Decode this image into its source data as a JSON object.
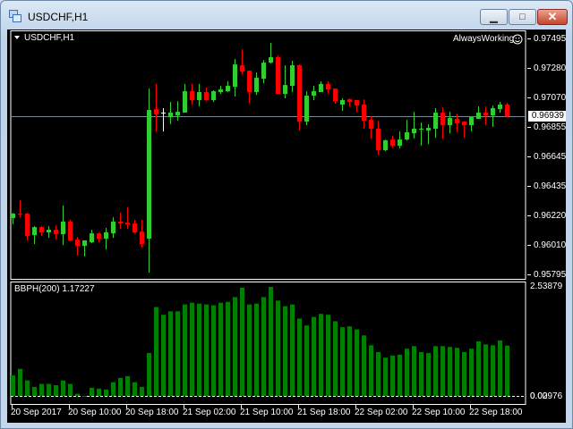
{
  "window": {
    "title": "USDCHF,H1",
    "minimize": "▁",
    "maximize": "□",
    "close": "✕"
  },
  "chart": {
    "symbol_label": "USDCHF,H1",
    "expert_label": "AlwaysWorking",
    "expert_icon": "smiley-icon",
    "current_price": "0.96939",
    "price_ticks": [
      "0.97495",
      "0.97280",
      "0.97070",
      "0.96855",
      "0.96645",
      "0.96435",
      "0.96220",
      "0.96010",
      "0.95795"
    ],
    "indicator_label": "BBPH(200) 1.17227",
    "indicator_ticks": [
      "2.53879",
      "0.02976",
      "0.00"
    ],
    "time_labels": [
      "20 Sep 2017",
      "20 Sep 10:00",
      "20 Sep 18:00",
      "21 Sep 02:00",
      "21 Sep 10:00",
      "21 Sep 18:00",
      "22 Sep 02:00",
      "22 Sep 10:00",
      "22 Sep 18:00"
    ],
    "colors": {
      "bull": "#32cd32",
      "bear": "#ff0000",
      "hist": "#008000",
      "bg": "#000000",
      "price_line": "#778899"
    }
  },
  "chart_data": {
    "type": "candlestick",
    "ylim": [
      0.95795,
      0.97495
    ],
    "ohlc": [
      [
        0.96207,
        0.96245,
        0.96162,
        0.96239
      ],
      [
        0.96239,
        0.96335,
        0.96213,
        0.96232
      ],
      [
        0.96239,
        0.96245,
        0.96046,
        0.96078
      ],
      [
        0.96084,
        0.96149,
        0.9602,
        0.96142
      ],
      [
        0.96142,
        0.96149,
        0.96078,
        0.96104
      ],
      [
        0.96104,
        0.96149,
        0.96065,
        0.96123
      ],
      [
        0.96123,
        0.96155,
        0.96052,
        0.96091
      ],
      [
        0.96091,
        0.96297,
        0.96013,
        0.96181
      ],
      [
        0.96181,
        0.96194,
        0.96039,
        0.96046
      ],
      [
        0.96052,
        0.96071,
        0.95936,
        0.96007
      ],
      [
        0.96007,
        0.96046,
        0.9593,
        0.96046
      ],
      [
        0.96033,
        0.96123,
        0.96026,
        0.96097
      ],
      [
        0.96097,
        0.96104,
        0.96033,
        0.96059
      ],
      [
        0.96059,
        0.96136,
        0.95981,
        0.96104
      ],
      [
        0.96097,
        0.96213,
        0.96065,
        0.96181
      ],
      [
        0.96181,
        0.96245,
        0.96129,
        0.96168
      ],
      [
        0.96174,
        0.96284,
        0.96129,
        0.96162
      ],
      [
        0.96168,
        0.96194,
        0.96097,
        0.96104
      ],
      [
        0.9611,
        0.96194,
        0.95994,
        0.9602
      ],
      [
        0.96059,
        0.9714,
        0.95814,
        0.96986
      ],
      [
        0.96992,
        0.97173,
        0.96831,
        0.96954
      ],
      [
        0.96967,
        0.96999,
        0.96831,
        0.96967
      ],
      [
        0.96934,
        0.97044,
        0.96883,
        0.96967
      ],
      [
        0.96947,
        0.9705,
        0.96909,
        0.96973
      ],
      [
        0.96967,
        0.97173,
        0.96967,
        0.97121
      ],
      [
        0.97121,
        0.97173,
        0.97025,
        0.97057
      ],
      [
        0.97057,
        0.97173,
        0.97012,
        0.97115
      ],
      [
        0.97115,
        0.97147,
        0.9705,
        0.97057
      ],
      [
        0.97057,
        0.97128,
        0.97044,
        0.97121
      ],
      [
        0.97115,
        0.9716,
        0.97102,
        0.97134
      ],
      [
        0.97121,
        0.97192,
        0.97115,
        0.9716
      ],
      [
        0.97153,
        0.97353,
        0.97083,
        0.97314
      ],
      [
        0.97308,
        0.97424,
        0.97244,
        0.97263
      ],
      [
        0.97269,
        0.97269,
        0.97037,
        0.97115
      ],
      [
        0.97115,
        0.97256,
        0.97095,
        0.97218
      ],
      [
        0.97211,
        0.97346,
        0.97179,
        0.97327
      ],
      [
        0.97327,
        0.97469,
        0.97321,
        0.97366
      ],
      [
        0.97366,
        0.97379,
        0.97102,
        0.97102
      ],
      [
        0.97102,
        0.97308,
        0.9707,
        0.97166
      ],
      [
        0.9716,
        0.9734,
        0.97115,
        0.97308
      ],
      [
        0.97308,
        0.97314,
        0.96838,
        0.96902
      ],
      [
        0.96902,
        0.97121,
        0.96876,
        0.97089
      ],
      [
        0.97089,
        0.9716,
        0.97057,
        0.97121
      ],
      [
        0.97115,
        0.97192,
        0.97115,
        0.97173
      ],
      [
        0.97173,
        0.97192,
        0.97102,
        0.97134
      ],
      [
        0.9714,
        0.9714,
        0.97031,
        0.9705
      ],
      [
        0.97025,
        0.9707,
        0.96979,
        0.97057
      ],
      [
        0.97063,
        0.9707,
        0.97012,
        0.97044
      ],
      [
        0.97057,
        0.97057,
        0.96973,
        0.97018
      ],
      [
        0.97025,
        0.97063,
        0.96851,
        0.96909
      ],
      [
        0.96915,
        0.96941,
        0.9678,
        0.96851
      ],
      [
        0.96851,
        0.96909,
        0.96664,
        0.96696
      ],
      [
        0.96696,
        0.96773,
        0.9669,
        0.96767
      ],
      [
        0.96773,
        0.96799,
        0.96715,
        0.96728
      ],
      [
        0.96728,
        0.96831,
        0.96709,
        0.96773
      ],
      [
        0.96773,
        0.96915,
        0.96767,
        0.96825
      ],
      [
        0.96818,
        0.96973,
        0.9678,
        0.96851
      ],
      [
        0.96844,
        0.96896,
        0.96728,
        0.96851
      ],
      [
        0.96838,
        0.96883,
        0.96741,
        0.96857
      ],
      [
        0.96851,
        0.96999,
        0.96786,
        0.96967
      ],
      [
        0.96967,
        0.97005,
        0.9678,
        0.96876
      ],
      [
        0.96876,
        0.96973,
        0.96818,
        0.96928
      ],
      [
        0.96922,
        0.9696,
        0.96825,
        0.96889
      ],
      [
        0.96902,
        0.96902,
        0.96786,
        0.96876
      ],
      [
        0.96876,
        0.96941,
        0.96831,
        0.96934
      ],
      [
        0.96922,
        0.97012,
        0.96922,
        0.96967
      ],
      [
        0.96967,
        0.97012,
        0.96876,
        0.96947
      ],
      [
        0.96947,
        0.97018,
        0.96864,
        0.96999
      ],
      [
        0.96992,
        0.97044,
        0.96967,
        0.97025
      ],
      [
        0.97025,
        0.97037,
        0.96934,
        0.96939
      ]
    ],
    "indicator": {
      "name": "BBPH(200)",
      "ylim": [
        0,
        2.53879
      ],
      "values": [
        0.48,
        0.63,
        0.36,
        0.21,
        0.28,
        0.28,
        0.25,
        0.36,
        0.28,
        0.05,
        -0.01,
        0.19,
        0.17,
        0.15,
        0.32,
        0.42,
        0.46,
        0.32,
        0.21,
        1.0,
        2.07,
        1.89,
        1.97,
        1.97,
        2.13,
        2.17,
        2.15,
        2.13,
        2.11,
        2.17,
        2.19,
        2.3,
        2.52,
        2.13,
        2.15,
        2.3,
        2.53879,
        2.22,
        2.09,
        2.13,
        1.8,
        1.64,
        1.84,
        1.91,
        1.89,
        1.74,
        1.6,
        1.62,
        1.55,
        1.41,
        1.18,
        1.02,
        0.89,
        0.94,
        0.96,
        1.1,
        1.16,
        1.02,
        1.0,
        1.16,
        1.16,
        1.14,
        1.12,
        1.02,
        1.1,
        1.27,
        1.2,
        1.18,
        1.29,
        1.17227
      ]
    }
  }
}
